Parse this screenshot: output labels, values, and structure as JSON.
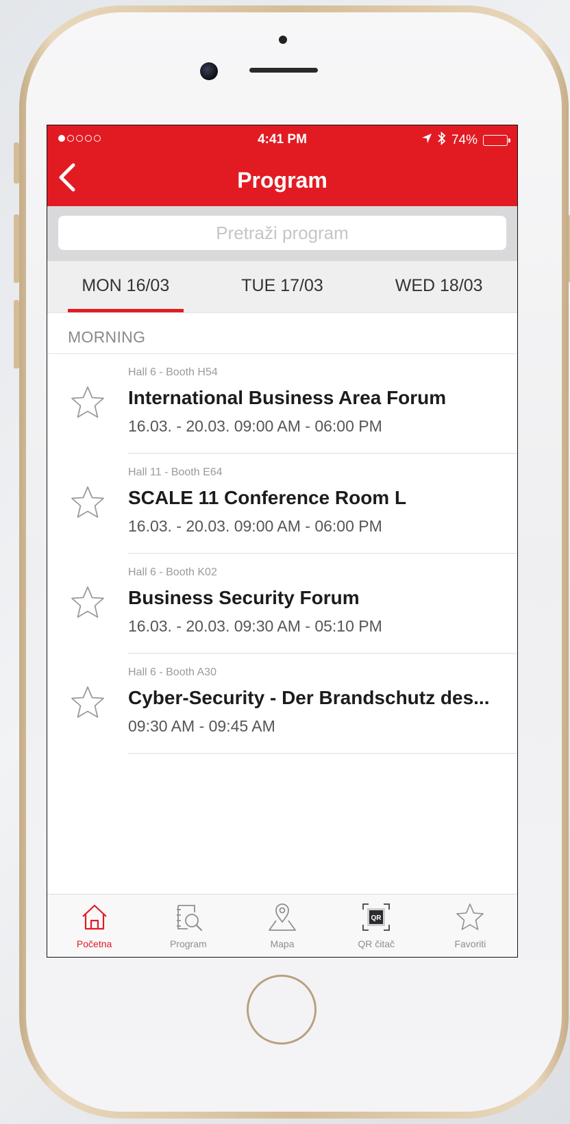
{
  "status_bar": {
    "time": "4:41 PM",
    "battery_text": "74%",
    "battery_level": 0.74,
    "signal_bars_filled": 1,
    "signal_bars_total": 5,
    "icons": [
      "location-arrow-icon",
      "bluetooth-icon",
      "battery-icon"
    ]
  },
  "header": {
    "title": "Program",
    "back_icon": "chevron-left-icon",
    "color": "#e21b23"
  },
  "search": {
    "placeholder": "Pretraži program",
    "value": ""
  },
  "day_tabs": [
    {
      "label": "MON 16/03",
      "active": true
    },
    {
      "label": "TUE 17/03",
      "active": false
    },
    {
      "label": "WED 18/03",
      "active": false
    }
  ],
  "section": {
    "label": "MORNING"
  },
  "events": [
    {
      "location": "Hall 6 - Booth H54",
      "name": "International Business Area Forum",
      "dates": "16.03. - 20.03. 09:00 AM - 06:00 PM",
      "favorite": false
    },
    {
      "location": "Hall 11 - Booth E64",
      "name": "SCALE 11 Conference Room L",
      "dates": "16.03. - 20.03. 09:00 AM - 06:00 PM",
      "favorite": false
    },
    {
      "location": "Hall 6 - Booth K02",
      "name": "Business Security Forum",
      "dates": "16.03. - 20.03. 09:30 AM - 05:10 PM",
      "favorite": false
    },
    {
      "location": "Hall 6 - Booth A30",
      "name": "Cyber-Security - Der Brandschutz des...",
      "dates": "09:30 AM - 09:45 AM",
      "favorite": false
    }
  ],
  "tabbar": [
    {
      "label": "Početna",
      "icon": "home-icon",
      "active": true
    },
    {
      "label": "Program",
      "icon": "program-search-icon",
      "active": false
    },
    {
      "label": "Mapa",
      "icon": "map-pin-icon",
      "active": false
    },
    {
      "label": "QR čitač",
      "icon": "qr-scanner-icon",
      "active": false
    },
    {
      "label": "Favoriti",
      "icon": "star-icon",
      "active": false
    }
  ],
  "colors": {
    "accent": "#e21b23",
    "inactive_icon": "#8e8e93"
  }
}
